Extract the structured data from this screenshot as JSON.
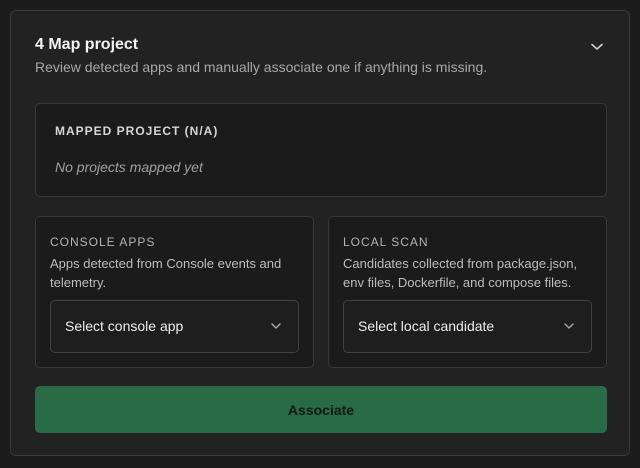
{
  "section": {
    "title": "4 Map project",
    "subtitle": "Review detected apps and manually associate one if anything is missing."
  },
  "mapped": {
    "heading": "MAPPED PROJECT (N/A)",
    "empty_text": "No projects mapped yet"
  },
  "console_apps": {
    "heading": "CONSOLE APPS",
    "description": "Apps detected from Console events and telemetry.",
    "select_value": "Select console app"
  },
  "local_scan": {
    "heading": "LOCAL SCAN",
    "description": "Candidates collected from package.json, env files, Dockerfile, and compose files.",
    "select_value": "Select local candidate"
  },
  "actions": {
    "associate_label": "Associate"
  },
  "icons": {
    "collapse": "chevron-down-icon",
    "select": "chevron-down-icon"
  },
  "colors": {
    "background": "#1c1c1c",
    "card": "#222222",
    "panel": "#1b1b1b",
    "accent": "#2a6b47"
  }
}
